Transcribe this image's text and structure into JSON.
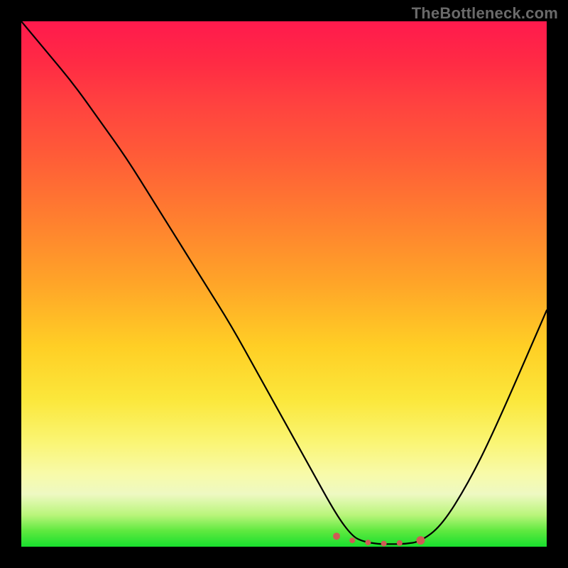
{
  "watermark": "TheBottleneck.com",
  "chart_data": {
    "type": "line",
    "title": "",
    "xlabel": "",
    "ylabel": "",
    "xlim": [
      0,
      100
    ],
    "ylim": [
      0,
      100
    ],
    "grid": false,
    "legend": false,
    "background_gradient": {
      "top_color": "#ff1a4d",
      "bottom_color": "#18df2e",
      "stops": [
        "red",
        "orange",
        "yellow",
        "pale-yellow",
        "green"
      ]
    },
    "series": [
      {
        "name": "bottleneck-curve",
        "color": "#000000",
        "x": [
          0,
          5,
          10,
          15,
          20,
          25,
          30,
          35,
          40,
          45,
          50,
          55,
          60,
          63,
          65,
          68,
          70,
          73,
          76,
          80,
          85,
          90,
          100
        ],
        "y": [
          100,
          94,
          88,
          81,
          74,
          66,
          58,
          50,
          42,
          33,
          24,
          15,
          6,
          2,
          1,
          0.5,
          0.5,
          0.5,
          1,
          4,
          12,
          22,
          45
        ]
      }
    ],
    "markers": [
      {
        "name": "flat-zone-left",
        "x": 60,
        "y": 2,
        "color": "#d05a55",
        "r": 5
      },
      {
        "name": "flat-zone-1",
        "x": 63,
        "y": 1.2,
        "color": "#d05a55",
        "r": 4
      },
      {
        "name": "flat-zone-2",
        "x": 66,
        "y": 0.8,
        "color": "#d05a55",
        "r": 4
      },
      {
        "name": "flat-zone-3",
        "x": 69,
        "y": 0.6,
        "color": "#d05a55",
        "r": 4
      },
      {
        "name": "flat-zone-4",
        "x": 72,
        "y": 0.7,
        "color": "#d05a55",
        "r": 4
      },
      {
        "name": "flat-zone-right",
        "x": 76,
        "y": 1.2,
        "color": "#d05a55",
        "r": 6
      }
    ],
    "annotations": []
  }
}
